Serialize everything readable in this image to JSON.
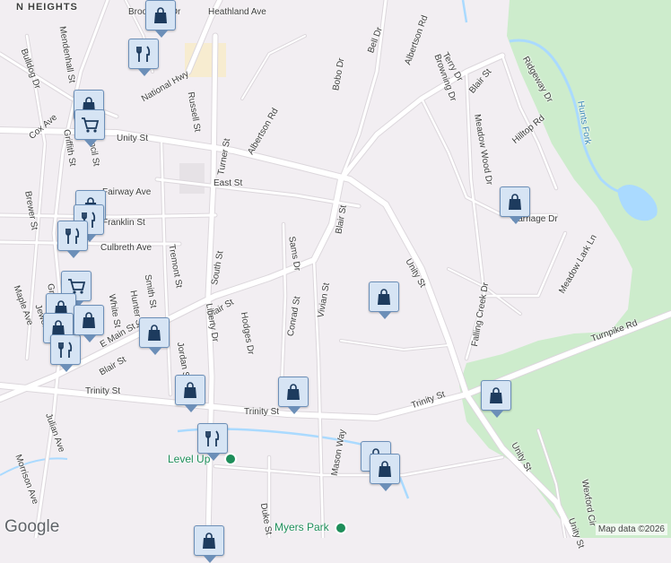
{
  "map": {
    "area_label": "N HEIGHTS",
    "water_labels": [
      "Hunts Fork"
    ],
    "poi_labels": [
      "Level Up",
      "Myers Park"
    ],
    "street_labels": [
      "Brookdale Dr",
      "Heathland Ave",
      "Bell Dr",
      "Albertson Rd",
      "Bobo Dr",
      "Mendenhall St",
      "Bulldog Dr",
      "National Hwy",
      "Russell St",
      "Browning Dr",
      "Terry Dr",
      "Ridgeway Dr",
      "Meadow Wood Dr",
      "Hilltop Rd",
      "Blair St",
      "Cox Ave",
      "Griffith St",
      "Council St",
      "Unity St",
      "Albertson Rd",
      "Turner St",
      "East St",
      "Fairway Ave",
      "Brewer St",
      "Franklin St",
      "Carriage Dr",
      "Culbreth Ave",
      "Tremont St",
      "South St",
      "Sams Dr",
      "Blair St",
      "Meadow Lark Ln",
      "Smith St",
      "Hunter St",
      "Griffith St",
      "White St",
      "Maple Ave",
      "Jewell St",
      "Unity St",
      "Falling Creek Dr",
      "Conrad St",
      "Vivian St",
      "Blair St",
      "Turnpike Rd",
      "Hodges Dr",
      "Liberty Dr",
      "Jordan St",
      "E Main St",
      "Blair St",
      "Trinity St",
      "Trinity St",
      "Trinity St",
      "Unity St",
      "Julian Ave",
      "Mason Way",
      "Morrison Ave",
      "Duke St",
      "Wexford Cir",
      "Unity St"
    ],
    "pins": [
      {
        "icon": "shopping-bag"
      },
      {
        "icon": "restaurant"
      },
      {
        "icon": "shopping-bag"
      },
      {
        "icon": "shopping-cart"
      },
      {
        "icon": "shopping-bag"
      },
      {
        "icon": "restaurant"
      },
      {
        "icon": "restaurant"
      },
      {
        "icon": "shopping-cart"
      },
      {
        "icon": "shopping-bag"
      },
      {
        "icon": "shopping-bag"
      },
      {
        "icon": "restaurant"
      },
      {
        "icon": "shopping-bag"
      },
      {
        "icon": "shopping-bag"
      },
      {
        "icon": "shopping-bag"
      },
      {
        "icon": "shopping-bag"
      },
      {
        "icon": "shopping-bag"
      },
      {
        "icon": "shopping-bag"
      },
      {
        "icon": "restaurant"
      },
      {
        "icon": "shopping-bag"
      },
      {
        "icon": "shopping-bag"
      },
      {
        "icon": "shopping-bag"
      },
      {
        "icon": "shopping-bag"
      }
    ],
    "colors": {
      "background": "#f2eef2",
      "road": "#ffffff",
      "road_casing": "#dcd7dc",
      "park": "#cdeccc",
      "water": "#aadaff",
      "pin_fill": "#d6e4f4",
      "pin_icon": "#1d3b5e"
    }
  },
  "footer": {
    "logo": "Google",
    "attribution": "Map data ©2026"
  }
}
